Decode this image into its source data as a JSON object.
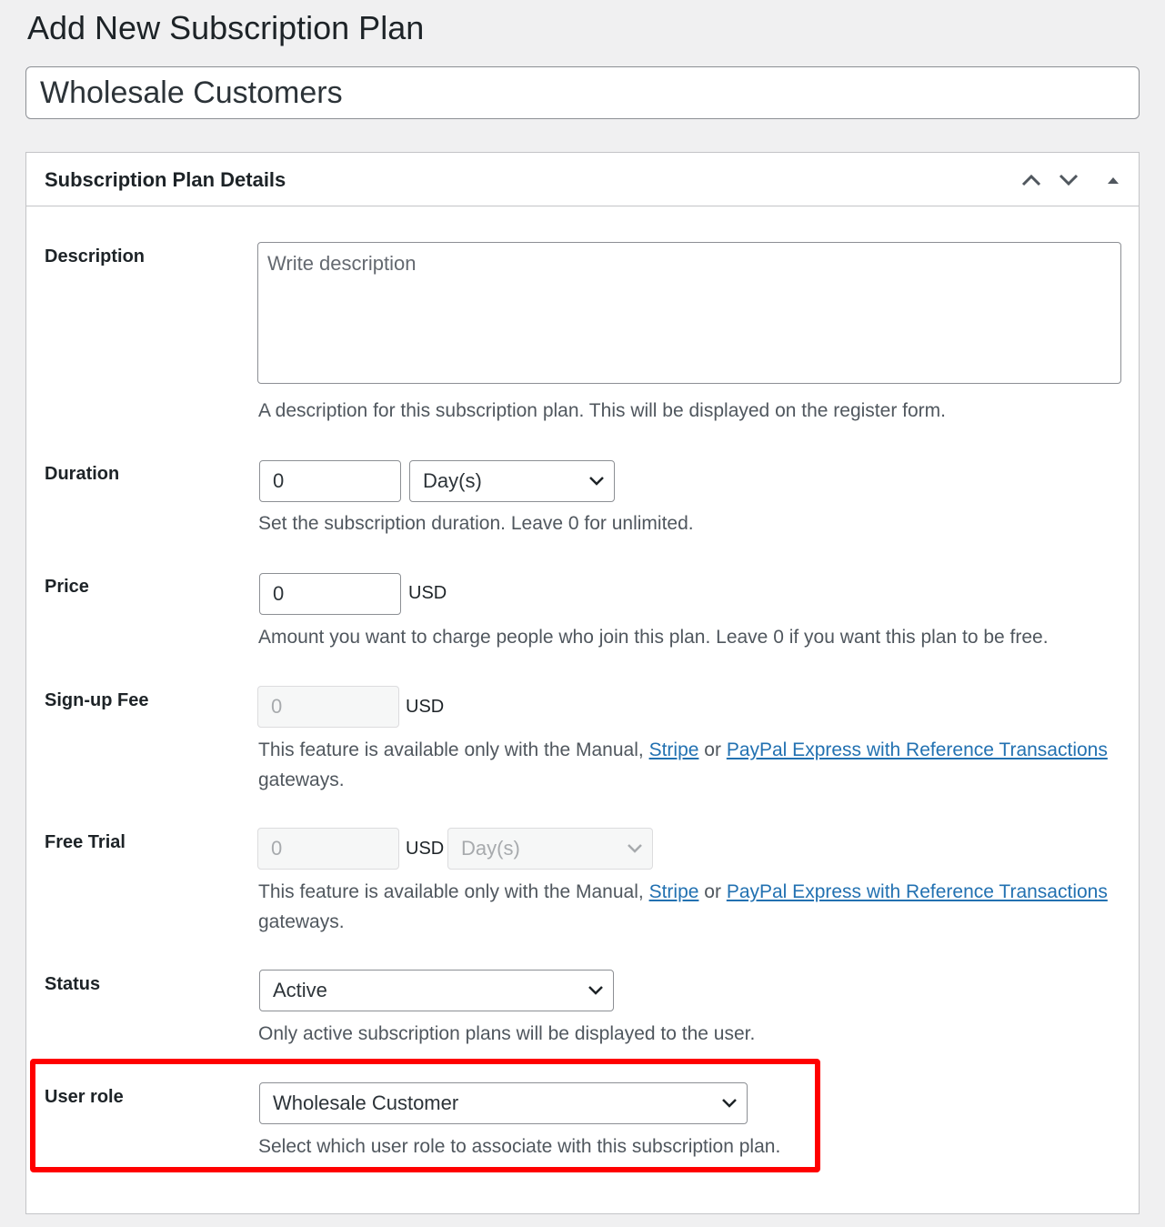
{
  "page": {
    "title": "Add New Subscription Plan",
    "plan_name": "Wholesale Customers"
  },
  "metabox": {
    "title": "Subscription Plan Details",
    "controls": [
      "move-up-icon",
      "move-down-icon",
      "toggle-panel-icon"
    ]
  },
  "description": {
    "label": "Description",
    "placeholder": "Write description",
    "value": "",
    "help": "A description for this subscription plan. This will be displayed on the register form."
  },
  "duration": {
    "label": "Duration",
    "value": "0",
    "unit": "Day(s)",
    "help": "Set the subscription duration. Leave 0 for unlimited."
  },
  "price": {
    "label": "Price",
    "value": "0",
    "currency": "USD",
    "help": "Amount you want to charge people who join this plan. Leave 0 if you want this plan to be free."
  },
  "signup_fee": {
    "label": "Sign-up Fee",
    "value": "0",
    "currency": "USD",
    "help_prefix": "This feature is available only with the Manual,",
    "link1": "Stripe",
    "help_or": "or",
    "link2": "PayPal Express with Reference Transactions",
    "help_suffix": "gateways."
  },
  "free_trial": {
    "label": "Free Trial",
    "value": "0",
    "currency": "USD",
    "unit": "Day(s)",
    "help_prefix": "This feature is available only with the Manual,",
    "link1": "Stripe",
    "help_or": "or",
    "link2": "PayPal Express with Reference Transactions",
    "help_suffix": "gateways."
  },
  "status": {
    "label": "Status",
    "value": "Active",
    "help": "Only active subscription plans will be displayed to the user."
  },
  "user_role": {
    "label": "User role",
    "value": "Wholesale Customer",
    "help": "Select which user role to associate with this subscription plan."
  },
  "colors": {
    "background": "#f0f0f1",
    "link": "#2271b1",
    "highlight": "#ff0000",
    "border": "#8c8f94"
  }
}
